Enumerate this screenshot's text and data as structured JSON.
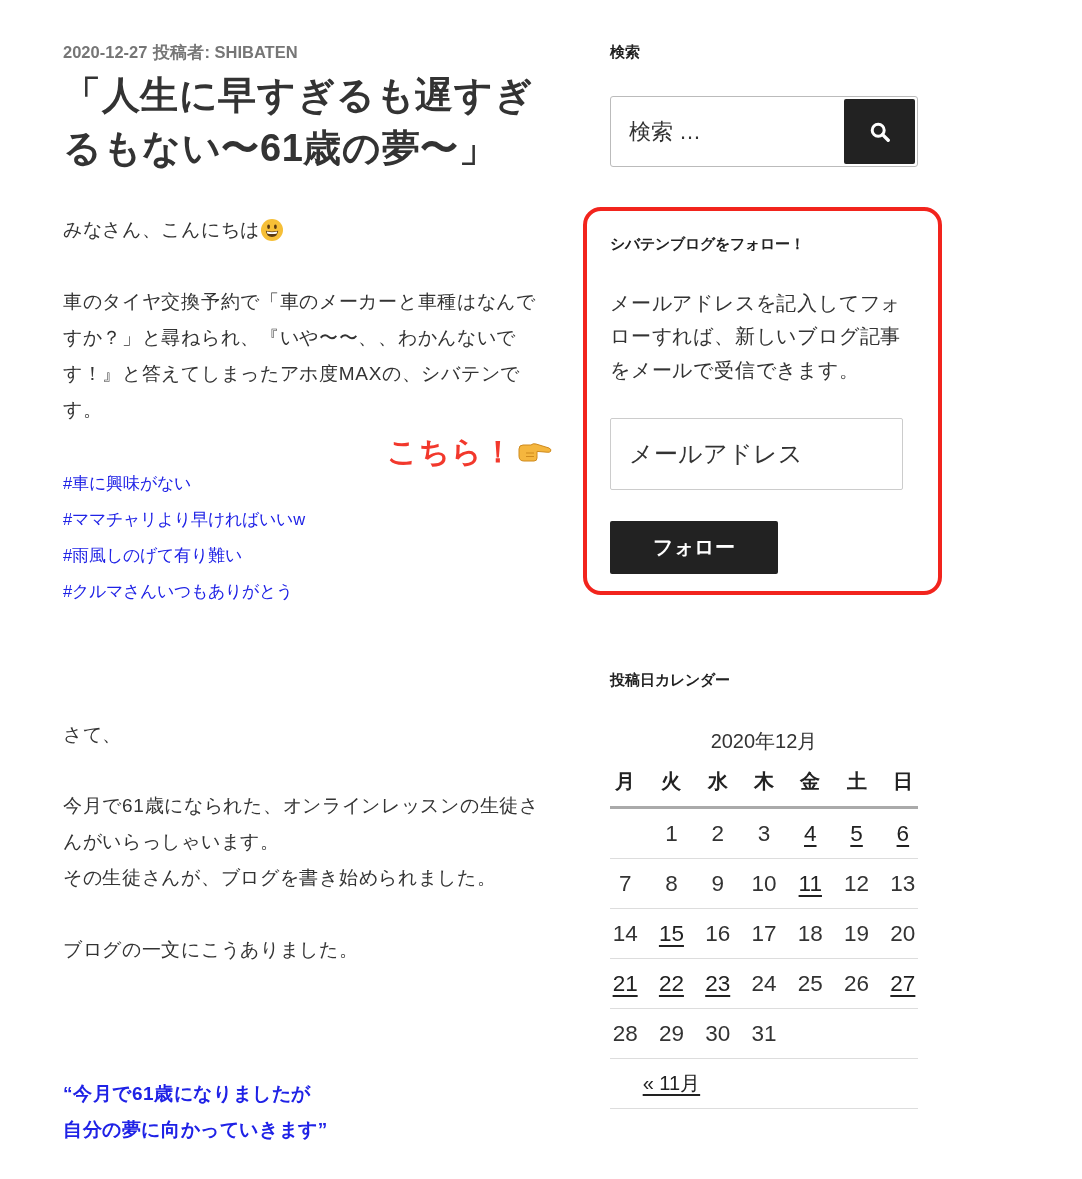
{
  "post": {
    "meta": {
      "date": "2020-12-27",
      "byline": "投稿者: SHIBATEN"
    },
    "title_lines": [
      "「人生に早すぎるも遅すぎ",
      "るもない〜61歳の夢〜」"
    ],
    "blocks": [
      {
        "kind": "emoji_line",
        "text": "みなさん、こんにちは"
      },
      {
        "kind": "paragraph",
        "lines": [
          "車のタイヤ交換予約で「車のメーカーと車種はなんで",
          "すか？」と尋ねられ、『いや〜〜、、わかんないで",
          "す！』と答えてしまったアホ度MAXの、シバテンで",
          "す。"
        ]
      },
      {
        "kind": "callout",
        "text": "こちら！"
      },
      {
        "kind": "hashtags",
        "items": [
          "#車に興味がない",
          "#ママチャリより早ければいいw",
          "#雨風しのげて有り難い",
          "#クルマさんいつもありがとう"
        ]
      },
      {
        "kind": "paragraph",
        "lines": [
          "さて、"
        ]
      },
      {
        "kind": "paragraph",
        "lines": [
          "今月で61歳になられた、オンラインレッスンの生徒さ",
          "んがいらっしゃいます。",
          "その生徒さんが、ブログを書き始められました。"
        ]
      },
      {
        "kind": "paragraph",
        "lines": [
          "ブログの一文にこうありました。"
        ]
      },
      {
        "kind": "quote",
        "lines": [
          "“今月で61歳になりましたが",
          "自分の夢に向かっていきます”"
        ]
      }
    ]
  },
  "sidebar": {
    "search": {
      "heading": "検索",
      "placeholder": "検索 …"
    },
    "follow": {
      "highlighted": true,
      "heading": "シバテンブログをフォロー！",
      "description_lines": [
        "メールアドレスを記入してフォ",
        "ローすれば、新しいブログ記事",
        "をメールで受信できます。"
      ],
      "email_placeholder": "メールアドレス",
      "button": "フォロー"
    },
    "calendar": {
      "heading": "投稿日カレンダー",
      "caption": "2020年12月",
      "weekdays": [
        "月",
        "火",
        "水",
        "木",
        "金",
        "土",
        "日"
      ],
      "weeks": [
        {
          "kind": "opening",
          "days": [
            {
              "day": "1",
              "linked": false
            },
            {
              "day": "2",
              "linked": false
            },
            {
              "day": "3",
              "linked": false
            },
            {
              "day": "4",
              "linked": true
            },
            {
              "day": "5",
              "linked": true
            },
            {
              "day": "6",
              "linked": true
            }
          ]
        },
        {
          "kind": "full",
          "days": [
            {
              "day": "7",
              "linked": false
            },
            {
              "day": "8",
              "linked": false
            },
            {
              "day": "9",
              "linked": false
            },
            {
              "day": "10",
              "linked": false
            },
            {
              "day": "11",
              "linked": true
            },
            {
              "day": "12",
              "linked": false
            },
            {
              "day": "13",
              "linked": false
            }
          ]
        },
        {
          "kind": "full",
          "days": [
            {
              "day": "14",
              "linked": false
            },
            {
              "day": "15",
              "linked": true
            },
            {
              "day": "16",
              "linked": false
            },
            {
              "day": "17",
              "linked": false
            },
            {
              "day": "18",
              "linked": false
            },
            {
              "day": "19",
              "linked": false
            },
            {
              "day": "20",
              "linked": false
            }
          ]
        },
        {
          "kind": "full",
          "days": [
            {
              "day": "21",
              "linked": true
            },
            {
              "day": "22",
              "linked": true
            },
            {
              "day": "23",
              "linked": true
            },
            {
              "day": "24",
              "linked": false
            },
            {
              "day": "25",
              "linked": false
            },
            {
              "day": "26",
              "linked": false
            },
            {
              "day": "27",
              "linked": true
            }
          ]
        },
        {
          "kind": "closing",
          "days": [
            {
              "day": "28",
              "linked": false
            },
            {
              "day": "29",
              "linked": false
            },
            {
              "day": "30",
              "linked": false
            },
            {
              "day": "31",
              "linked": false
            }
          ]
        }
      ],
      "prev_link": "« 11月"
    }
  }
}
